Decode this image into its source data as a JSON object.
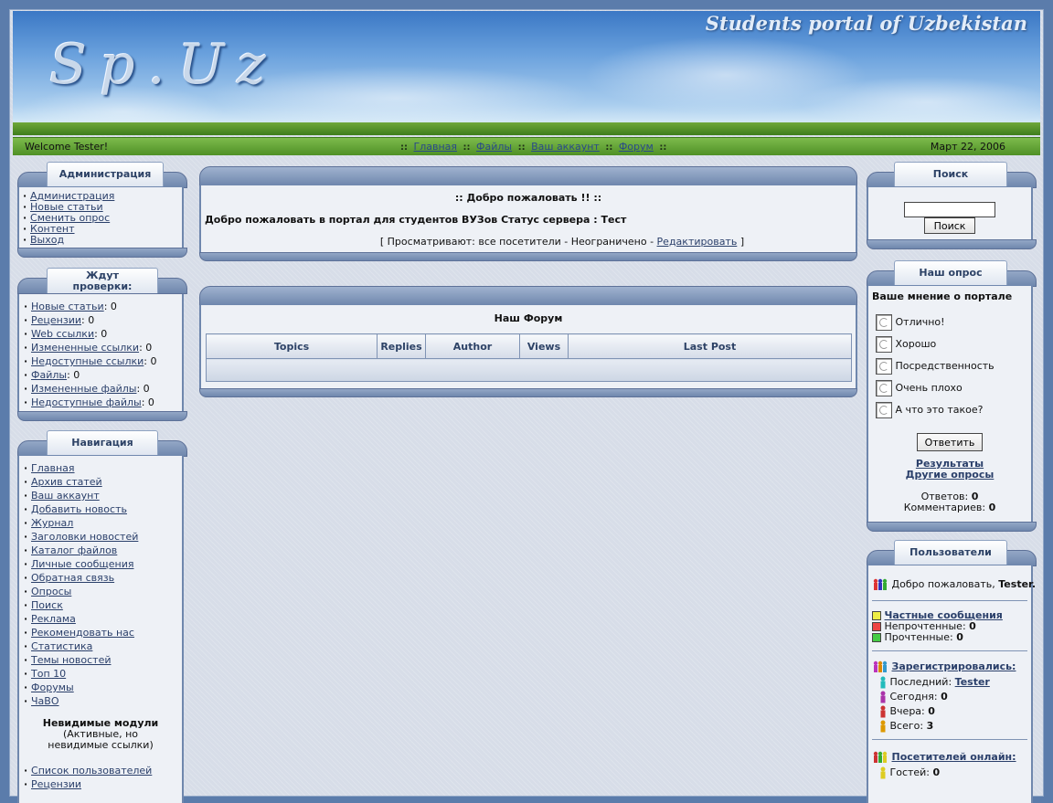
{
  "header": {
    "logo_text": "Sp.Uz",
    "tagline": "Students portal of Uzbekistan",
    "welcome": "Welcome Tester!",
    "date": "Март 22, 2006",
    "nav": [
      "Главная",
      "Файлы",
      "Ваш аккаунт",
      "Форум"
    ],
    "nav_sep": "::"
  },
  "left": {
    "admin": {
      "title": "Администрация",
      "items": [
        "Администрация",
        "Новые статьи",
        "Сменить опрос",
        "Контент",
        "Выход"
      ]
    },
    "waiting": {
      "title_line1": "Ждут",
      "title_line2": "проверки:",
      "items": [
        {
          "label": "Новые статьи",
          "count": ": 0"
        },
        {
          "label": "Рецензии",
          "count": ": 0"
        },
        {
          "label": "Web ссылки",
          "count": ": 0"
        },
        {
          "label": "Измененные ссылки",
          "count": ": 0"
        },
        {
          "label": "Недоступные ссылки",
          "count": ": 0"
        },
        {
          "label": "Файлы",
          "count": ": 0"
        },
        {
          "label": "Измененные файлы",
          "count": ": 0"
        },
        {
          "label": "Недоступные файлы",
          "count": ": 0"
        }
      ]
    },
    "navigation": {
      "title": "Навигация",
      "items": [
        "Главная",
        "Архив статей",
        "Ваш аккаунт",
        "Добавить новость",
        "Журнал",
        "Заголовки новостей",
        "Каталог файлов",
        "Личные сообщения",
        "Обратная связь",
        "Опросы",
        "Поиск",
        "Реклама",
        "Рекомендовать нас",
        "Статистика",
        "Темы новостей",
        "Топ 10",
        "Форумы",
        "ЧаВО"
      ],
      "invisible_title": "Невидимые модули",
      "invisible_note": "(Активные, но невидимые ссылки)",
      "invisible_items": [
        "Список пользователей",
        "Рецензии"
      ]
    }
  },
  "center": {
    "welcome": {
      "heading": ":: Добро пожаловать !! ::",
      "text": "Добро пожаловать в портал для студентов ВУЗов Статус сервера : Тест",
      "view_prefix": "[ Просматривают: все посетители - Неограничено - ",
      "edit_link": "Редактировать",
      "view_suffix": " ]"
    },
    "forum": {
      "title": "Наш Форум",
      "columns": [
        "Topics",
        "Replies",
        "Author",
        "Views",
        "Last Post"
      ]
    }
  },
  "right": {
    "search": {
      "title": "Поиск",
      "input_value": "",
      "button": "Поиск"
    },
    "poll": {
      "title": "Наш опрос",
      "question": "Ваше мнение о портале",
      "options": [
        "Отлично!",
        "Хорошо",
        "Посредственность",
        "Очень плохо",
        "А что это такое?"
      ],
      "vote_button": "Ответить",
      "results_link": "Результаты",
      "other_link": "Другие опросы",
      "answers_label": "Ответов:",
      "answers_value": "0",
      "comments_label": "Комментариев:",
      "comments_value": "0"
    },
    "users": {
      "title": "Пользователи",
      "welcome_prefix": "Добро пожаловать,",
      "username": "Tester.",
      "pm_link": "Частные сообщения",
      "unread_label": "Непрочтенные:",
      "unread_value": "0",
      "read_label": "Прочтенные:",
      "read_value": "0",
      "registered_link": "Зарегистрировались:",
      "last_label": "Последний:",
      "last_value": "Tester",
      "today_label": "Сегодня:",
      "today_value": "0",
      "yesterday_label": "Вчера:",
      "yesterday_value": "0",
      "total_label": "Всего:",
      "total_value": "3",
      "online_link": "Посетителей онлайн:",
      "guests_label": "Гостей:",
      "guests_value": "0"
    }
  }
}
